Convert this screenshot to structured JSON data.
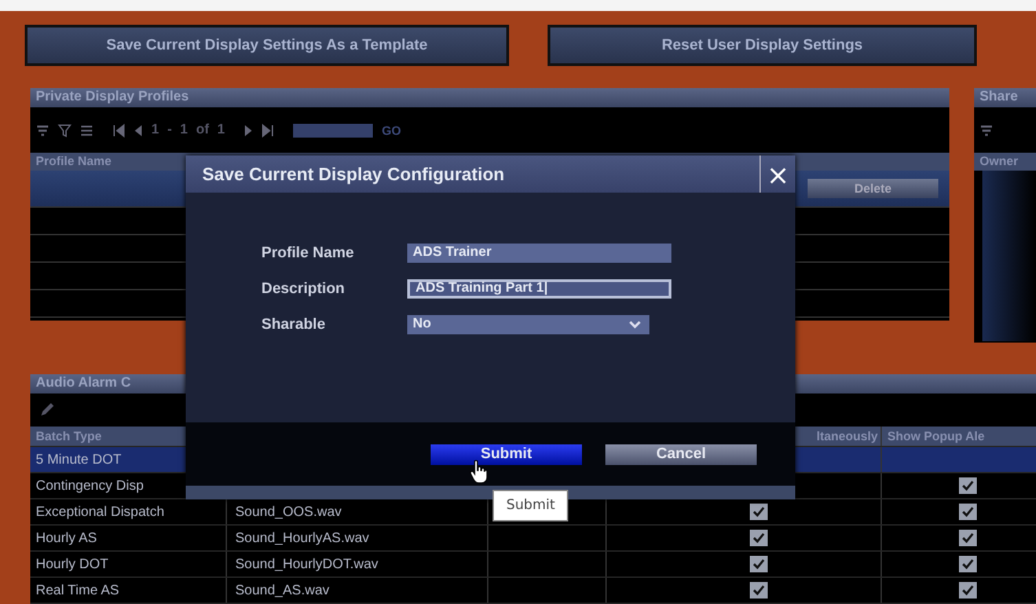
{
  "top_buttons": [
    {
      "label": "Save Current Display Settings As a Template"
    },
    {
      "label": "Reset User Display Settings"
    }
  ],
  "private_profiles": {
    "title": "Private Display Profiles",
    "pager": {
      "first": "1",
      "dash": "-",
      "current": "1",
      "of": "of",
      "total": "1"
    },
    "go": "GO",
    "column": "Profile Name",
    "delete_button": "Delete",
    "rows": [
      {
        "selected": true
      },
      {
        "selected": false
      },
      {
        "selected": false
      },
      {
        "selected": false
      },
      {
        "selected": false
      }
    ]
  },
  "shared_profiles": {
    "title": "Share",
    "column": "Owner"
  },
  "audio_alarms": {
    "title": "Audio Alarm C",
    "header": {
      "batch_type": "Batch Type",
      "column_4": "ltaneously",
      "column_5": "Show Popup Ale"
    },
    "rows": [
      {
        "batch_type": "5 Minute DOT",
        "selected": true,
        "column_5_checked": false
      },
      {
        "batch_type": "Contingency Disp",
        "selected": false,
        "column_5_checked": true
      },
      {
        "batch_type": "Exceptional Dispatch",
        "sound": "Sound_OOS.wav",
        "selected": false,
        "column_4_checked": true,
        "column_5_checked": true
      },
      {
        "batch_type": "Hourly AS",
        "sound": "Sound_HourlyAS.wav",
        "selected": false,
        "column_4_checked": true,
        "column_5_checked": true
      },
      {
        "batch_type": "Hourly DOT",
        "sound": "Sound_HourlyDOT.wav",
        "selected": false,
        "column_4_checked": true,
        "column_5_checked": true
      },
      {
        "batch_type": "Real Time AS",
        "sound": "Sound_AS.wav",
        "selected": false,
        "column_4_checked": true,
        "column_5_checked": true
      }
    ]
  },
  "dialog": {
    "title": "Save Current Display Configuration",
    "close": "×",
    "fields": [
      {
        "label": "Profile Name",
        "value": "ADS Trainer",
        "kind": "text",
        "focused": false
      },
      {
        "label": "Description",
        "value": "ADS Training Part 1|",
        "kind": "text",
        "focused": true
      },
      {
        "label": "Sharable",
        "value": "No",
        "kind": "select",
        "focused": false
      }
    ],
    "buttons": [
      {
        "label": "Submit",
        "hovered": true
      },
      {
        "label": "Cancel",
        "hovered": false
      }
    ],
    "tooltip": "Submit"
  }
}
